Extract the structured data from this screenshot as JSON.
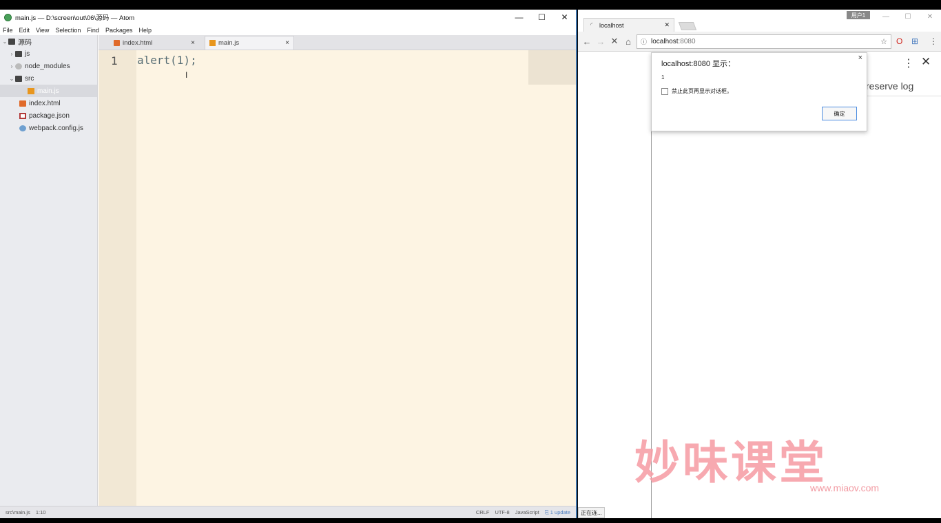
{
  "atom": {
    "title": "main.js — D:\\screen\\out\\06\\源码 — Atom",
    "window_buttons": [
      "—",
      "☐",
      "✕"
    ],
    "menu": [
      "File",
      "Edit",
      "View",
      "Selection",
      "Find",
      "Packages",
      "Help"
    ],
    "tree": [
      {
        "label": "源码",
        "type": "folder",
        "expanded": true
      },
      {
        "label": "js",
        "type": "folder",
        "expanded": false
      },
      {
        "label": "node_modules",
        "type": "module",
        "expanded": false
      },
      {
        "label": "src",
        "type": "folder",
        "expanded": true
      },
      {
        "label": "main.js",
        "type": "js",
        "selected": true
      },
      {
        "label": "index.html",
        "type": "html"
      },
      {
        "label": "package.json",
        "type": "json"
      },
      {
        "label": "webpack.config.js",
        "type": "gear"
      }
    ],
    "tabs": [
      {
        "label": "index.html",
        "icon": "html-file-icon",
        "active": false
      },
      {
        "label": "main.js",
        "icon": "js-file-icon",
        "active": true
      }
    ],
    "editor": {
      "line_number": "1",
      "code": "alert(1);"
    },
    "status": {
      "path": "src\\main.js",
      "cursor": "1:10",
      "line_ending": "CRLF",
      "encoding": "UTF-8",
      "grammar": "JavaScript",
      "update": "1 update"
    }
  },
  "chrome": {
    "tab_title": "localhost",
    "user_badge": "用户1",
    "window_buttons": [
      "—",
      "☐",
      "✕"
    ],
    "url_host": "localhost",
    "url_port": ":8080",
    "devtools": {
      "preserve_log": "reserve log"
    },
    "dialog": {
      "title": "localhost:8080 显示：",
      "message": "1",
      "checkbox_label": "禁止此页再显示对话框。",
      "ok_label": "确定"
    },
    "status_text": "正在连..."
  },
  "watermark": {
    "text": "妙味课堂",
    "url": "www.miaov.com"
  },
  "colors": {
    "editor_bg": "#fdf4e3",
    "gutter_bg": "#f2e8d5",
    "tree_bg": "#eaebef",
    "watermark": "#f7a0a8",
    "dialog_ok_border": "#4a8be0"
  }
}
